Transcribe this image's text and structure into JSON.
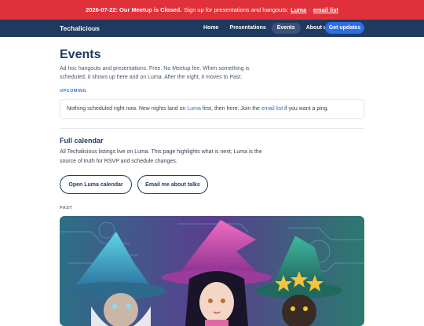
{
  "banner": {
    "date_status": "2026-07-22: Our Meetup is Closed.",
    "text": "Sign up for presentations and hangouts:",
    "link1": "Luma",
    "separator": "·",
    "link2": "email list"
  },
  "nav": {
    "brand": "Techalicious",
    "links": [
      "Home",
      "Presentations",
      "Events",
      "About us"
    ],
    "active": "Events",
    "cta": "Get updates"
  },
  "page": {
    "title": "Events",
    "intro": "Ad hoc hangouts and presentations. Free. No Meetup fee. When something is scheduled, it shows up here and on Luma. After the night, it moves to Past."
  },
  "upcoming": {
    "label": "UPCOMING",
    "text_before": "Nothing scheduled right now. New nights land on",
    "link1": "Luma",
    "text_middle": "first, then here. Join the",
    "link2": "email list",
    "text_after": "if you want a ping."
  },
  "calendar": {
    "heading": "Full calendar",
    "text": "All Techalicious listings live on Luma. This page highlights what is next; Luma is the source of truth for RSVP and schedule changes.",
    "button1": "Open Luma calendar",
    "button2": "Email me about talks"
  },
  "past": {
    "label": "PAST"
  },
  "colors": {
    "banner": "#e0313a",
    "nav": "#1f3a5f",
    "accent": "#2b6de6"
  }
}
